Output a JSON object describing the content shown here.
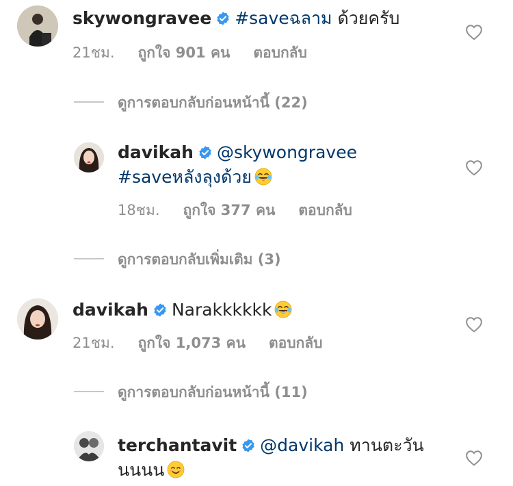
{
  "comments": [
    {
      "username": "skywongravee",
      "text_link": "#saveฉลาม",
      "text_rest": " ด้วยครับ",
      "time": "21ชม.",
      "likes": "ถูกใจ 901 คน",
      "reply": "ตอบกลับ"
    },
    {
      "username": "davikah",
      "text_link": "@skywongravee",
      "text_line2_link": "#saveหลังลุงด้วย",
      "emoji": "face-with-tears-of-joy",
      "time": "18ชม.",
      "likes": "ถูกใจ 377 คน",
      "reply": "ตอบกลับ"
    },
    {
      "username": "davikah",
      "text_rest": "Narakkkkkk",
      "emoji": "face-with-tears-of-joy",
      "time": "21ชม.",
      "likes": "ถูกใจ 1,073 คน",
      "reply": "ตอบกลับ"
    },
    {
      "username": "terchantavit",
      "text_link": "@davikah",
      "text_rest": " ทานตะวัน",
      "text_line2": "นนนน",
      "emoji": "smiling-face-with-smiling-eyes"
    }
  ],
  "view_replies": [
    "ดูการตอบกลับก่อนหน้านี้ (22)",
    "ดูการตอบกลับเพิ่มเติม (3)",
    "ดูการตอบกลับก่อนหน้านี้ (11)"
  ],
  "colors": {
    "link": "#00376b",
    "verified": "#3897f0",
    "meta": "#8e8e8e",
    "text": "#262626"
  },
  "icons": {
    "verified": "verified-badge-icon",
    "like": "heart-outline-icon"
  }
}
